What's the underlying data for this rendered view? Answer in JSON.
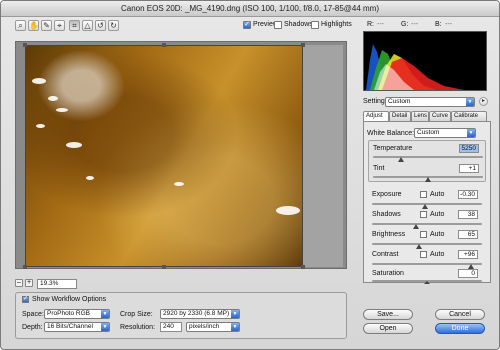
{
  "window": {
    "title": "Canon EOS 20D:  _MG_4190.dng  (ISO 100, 1/100, f/8.0, 17-85@44 mm)"
  },
  "toolbar": {
    "tools": [
      "zoom-tool-icon",
      "hand-tool-icon",
      "white-balance-tool-icon",
      "color-sampler-tool-icon",
      "crop-tool-icon",
      "straighten-tool-icon",
      "rotate-left-icon",
      "rotate-right-icon"
    ],
    "preview": {
      "label": "Preview",
      "checked": true
    },
    "shadows": {
      "label": "Shadows",
      "checked": false
    },
    "highlights": {
      "label": "Highlights",
      "checked": false
    }
  },
  "readouts": {
    "r": "R:",
    "g": "G:",
    "b": "B:",
    "r_val": "---",
    "g_val": "---",
    "b_val": "---"
  },
  "histogram": {
    "colors": [
      "#1a5bd6",
      "#2ea42e",
      "#e8e021",
      "#e81f1f"
    ]
  },
  "settings": {
    "label": "Settings:",
    "value": "Custom"
  },
  "tabs": [
    "Adjust",
    "Detail",
    "Lens",
    "Curve",
    "Calibrate"
  ],
  "adjust": {
    "white_balance": {
      "label": "White Balance:",
      "value": "Custom"
    },
    "temperature": {
      "label": "Temperature",
      "value": "5250",
      "level": 0.25
    },
    "tint": {
      "label": "Tint",
      "value": "+1",
      "level": 0.5
    },
    "exposure": {
      "label": "Exposure",
      "auto": "Auto",
      "value": "-0.30",
      "level": 0.48
    },
    "shadows": {
      "label": "Shadows",
      "auto": "Auto",
      "value": "38",
      "level": 0.4
    },
    "brightness": {
      "label": "Brightness",
      "auto": "Auto",
      "value": "65",
      "level": 0.43
    },
    "contrast": {
      "label": "Contrast",
      "auto": "Auto",
      "value": "+96",
      "level": 0.9
    },
    "saturation": {
      "label": "Saturation",
      "value": "0",
      "level": 0.5
    }
  },
  "zoom": {
    "minus": "–",
    "plus": "+",
    "value": "19.3%"
  },
  "workflow": {
    "show_label": "Show Workflow Options",
    "space_label": "Space:",
    "space_value": "ProPhoto RGB",
    "depth_label": "Depth:",
    "depth_value": "16 Bits/Channel",
    "crop_label": "Crop Size:",
    "crop_value": "2920 by 2330  (6.8 MP)",
    "res_label": "Resolution:",
    "res_value": "240",
    "res_unit": "pixels/inch"
  },
  "buttons": {
    "save": "Save...",
    "cancel": "Cancel",
    "open": "Open",
    "done": "Done"
  }
}
